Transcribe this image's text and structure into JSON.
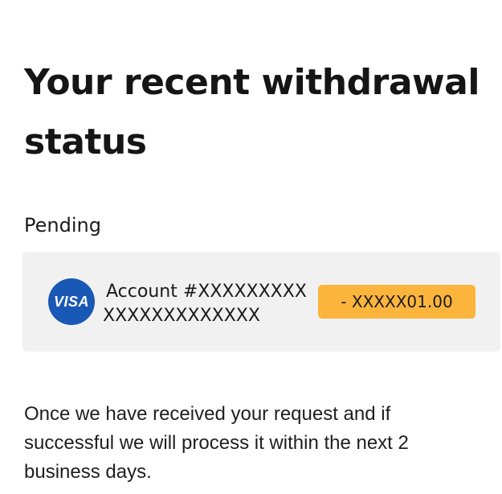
{
  "page": {
    "title": "Your recent withdrawal status",
    "status_label": "Pending",
    "description": "Once we have received your request and if successful we will process it within the next 2 business days."
  },
  "withdrawal": {
    "card_brand": "VISA",
    "account_line1": "Account #XXXXXXXXX",
    "account_line2": "XXXXXXXXXXXXX",
    "amount": "- XXXXX01.00",
    "amount_bg_color": "#fbb53c",
    "brand_color": "#1a58b5"
  }
}
